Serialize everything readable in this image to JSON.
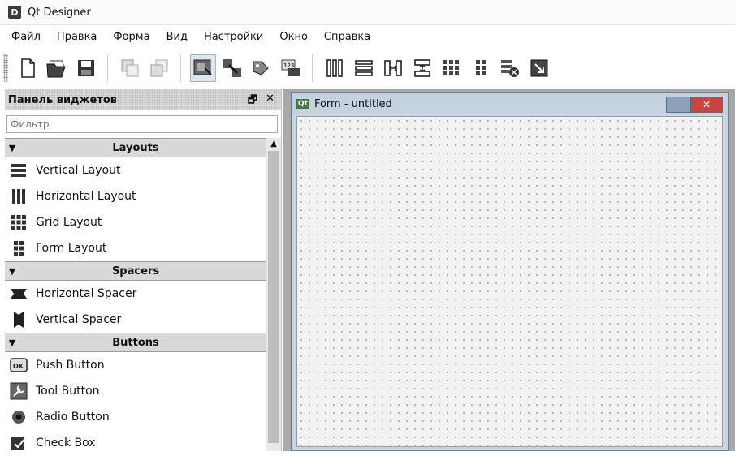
{
  "window": {
    "app_icon": "D",
    "title": "Qt Designer"
  },
  "menu": [
    "Файл",
    "Правка",
    "Форма",
    "Вид",
    "Настройки",
    "Окно",
    "Справка"
  ],
  "toolbar_icons": [
    "new-file-icon",
    "open-file-icon",
    "save-icon",
    "send-to-back-icon",
    "bring-to-front-icon",
    "edit-widgets-icon",
    "edit-signals-slots-icon",
    "edit-buddies-icon",
    "edit-tab-order-icon",
    "layout-horizontal-icon",
    "layout-vertical-icon",
    "layout-horizontal-splitter-icon",
    "layout-vertical-splitter-icon",
    "layout-grid-icon",
    "layout-form-icon",
    "break-layout-icon",
    "adjust-size-icon"
  ],
  "widget_box": {
    "title": "Панель виджетов",
    "float_glyph": "🗗",
    "close_glyph": "✕",
    "filter_placeholder": "Фильтр",
    "categories": [
      {
        "name": "Layouts",
        "items": [
          "Vertical Layout",
          "Horizontal Layout",
          "Grid Layout",
          "Form Layout"
        ]
      },
      {
        "name": "Spacers",
        "items": [
          "Horizontal Spacer",
          "Vertical Spacer"
        ]
      },
      {
        "name": "Buttons",
        "items": [
          "Push Button",
          "Tool Button",
          "Radio Button",
          "Check Box"
        ]
      }
    ]
  },
  "form": {
    "badge": "Qt",
    "title": "Form - untitled",
    "min_glyph": "—",
    "close_glyph": "✕"
  }
}
